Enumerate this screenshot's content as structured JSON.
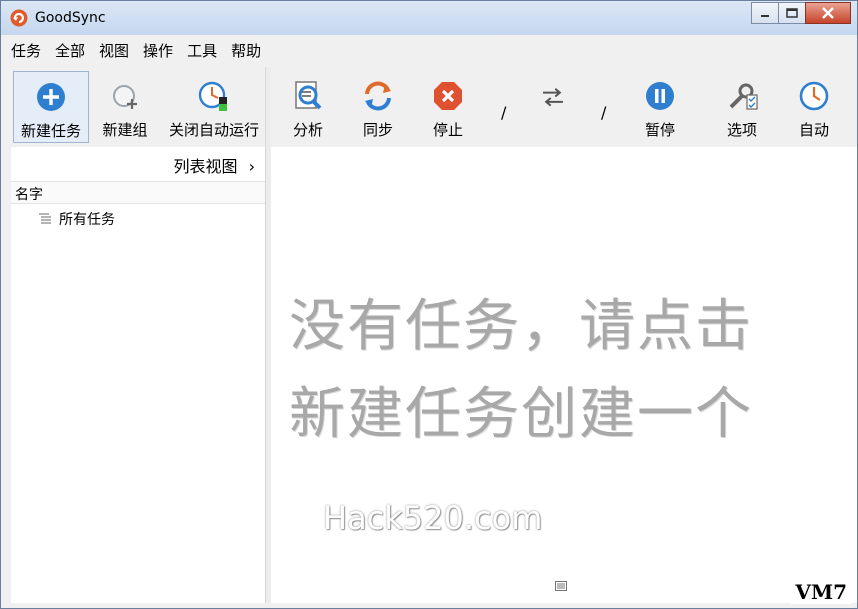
{
  "window": {
    "title": "GoodSync"
  },
  "menu": [
    "任务",
    "全部",
    "视图",
    "操作",
    "工具",
    "帮助"
  ],
  "toolbar_left": {
    "new_job": "新建任务",
    "new_group": "新建组",
    "auto_off": "关闭自动运行"
  },
  "toolbar_right": {
    "analyze": "分析",
    "sync": "同步",
    "stop": "停止",
    "slash1": "/",
    "slash2": "/",
    "pause": "暂停",
    "options": "选项",
    "auto": "自动"
  },
  "left_panel": {
    "list_view": "列表视图",
    "column_name": "名字",
    "tree_all_jobs": "所有任务"
  },
  "main": {
    "empty_line1": "没有任务，请点击",
    "empty_line2": "新建任务创建一个",
    "watermark": "Hack520.com",
    "badge": "VM7"
  },
  "colors": {
    "accent_blue": "#2f7fd1",
    "stop_red": "#e0512f",
    "sync_orange": "#e06a2a"
  }
}
